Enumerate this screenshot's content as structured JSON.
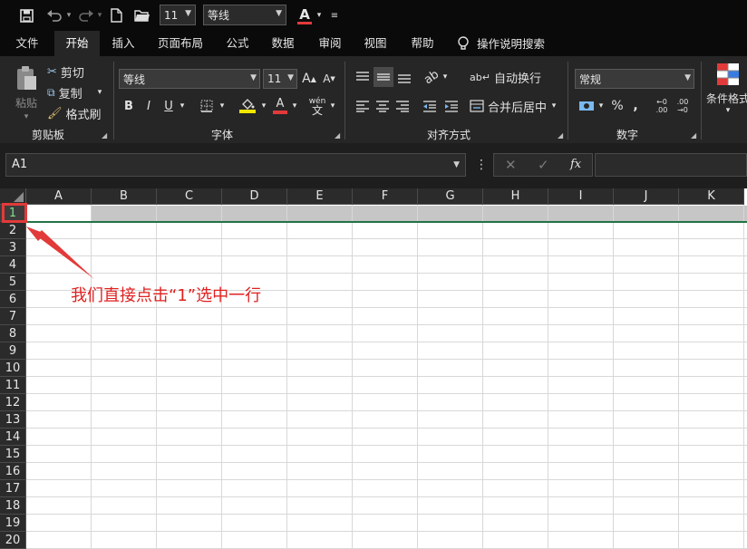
{
  "quick_access": {
    "font_size": "11",
    "font_name": "等线",
    "font_color_glyph": "A",
    "save_icon": "save-icon",
    "undo_icon": "undo-icon",
    "redo_icon": "redo-icon",
    "new_icon": "new-document-icon",
    "open_icon": "open-folder-icon"
  },
  "tabs": [
    {
      "label": "文件"
    },
    {
      "label": "开始"
    },
    {
      "label": "插入"
    },
    {
      "label": "页面布局"
    },
    {
      "label": "公式"
    },
    {
      "label": "数据"
    },
    {
      "label": "审阅"
    },
    {
      "label": "视图"
    },
    {
      "label": "帮助"
    }
  ],
  "tell_me": "操作说明搜索",
  "ribbon": {
    "clipboard": {
      "label": "剪贴板",
      "paste": "粘贴",
      "cut": "剪切",
      "copy": "复制",
      "format_painter": "格式刷"
    },
    "font": {
      "label": "字体",
      "font_name": "等线",
      "font_size": "11",
      "grow": "A",
      "shrink": "A",
      "bold": "B",
      "italic": "I",
      "underline": "U",
      "font_color": "A",
      "phonetic": "wén"
    },
    "alignment": {
      "label": "对齐方式",
      "wrap_text": "自动换行",
      "merge_center": "合并后居中"
    },
    "number": {
      "label": "数字",
      "format": "常规",
      "percent": "%",
      "comma": ",",
      "inc_decimal": "←0 .00",
      "dec_decimal": ".00 →0"
    },
    "styles": {
      "conditional": "条件格式"
    }
  },
  "formula_bar": {
    "name_box": "A1",
    "cancel": "✕",
    "enter": "✓",
    "fx": "fx",
    "more": "⋮"
  },
  "sheet": {
    "columns": [
      "A",
      "B",
      "C",
      "D",
      "E",
      "F",
      "G",
      "H",
      "I",
      "J",
      "K"
    ],
    "rows": [
      "1",
      "2",
      "3",
      "4",
      "5",
      "6",
      "7",
      "8",
      "9",
      "10",
      "11",
      "12",
      "13",
      "14",
      "15",
      "16",
      "17",
      "18",
      "19",
      "20"
    ],
    "selected_row": "1"
  },
  "annotation": "我们直接点击“1”选中一行",
  "colors": {
    "highlight": "#e23a3a",
    "selection_border": "#217346",
    "ribbon_bg": "#262626"
  }
}
